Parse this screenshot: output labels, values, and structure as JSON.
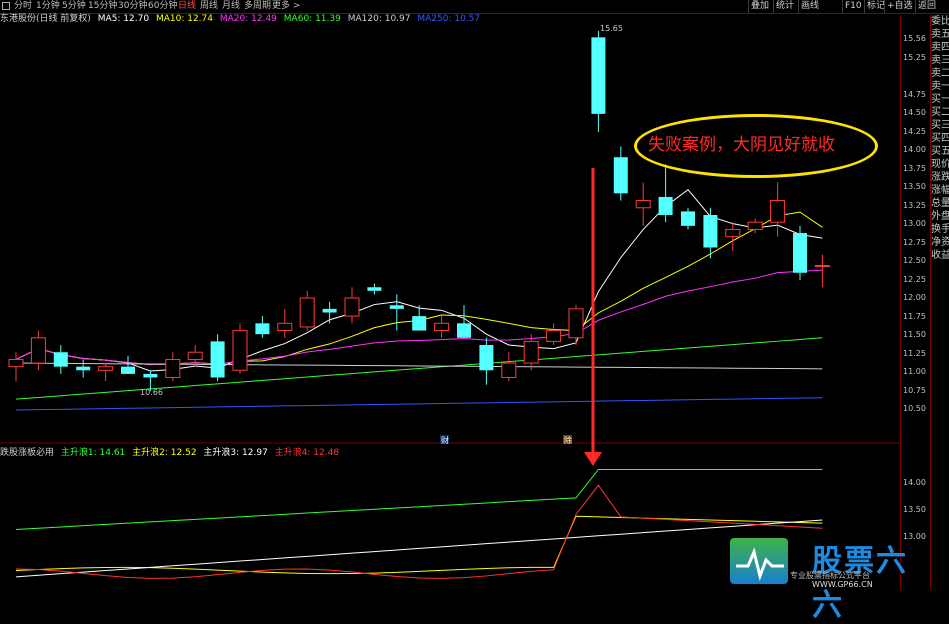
{
  "top_tabs": {
    "items": [
      "分时",
      "1分钟",
      "5分钟",
      "15分钟",
      "30分钟",
      "60分钟",
      "日线",
      "周线",
      "月线",
      "多周期",
      "更多 >"
    ],
    "active": "日线",
    "buttons": [
      "叠加",
      "统计",
      "画线",
      "F10",
      "标记",
      "+自选",
      "返回"
    ]
  },
  "ma_legend": {
    "stock": "东港股份(日线 前复权)",
    "items": [
      {
        "text": "MA5: 12.70",
        "color": "#ffffff"
      },
      {
        "text": "MA10: 12.74",
        "color": "#ffff00"
      },
      {
        "text": "MA20: 12.49",
        "color": "#ff33ff"
      },
      {
        "text": "MA60: 11.39",
        "color": "#33ff33"
      },
      {
        "text": "MA120: 10.97",
        "color": "#cccccc"
      },
      {
        "text": "MA250: 10.57",
        "color": "#3355ff"
      }
    ]
  },
  "indicator_legend": {
    "name": "跌股涨板必用",
    "items": [
      {
        "text": "主升浪1: 14.61",
        "color": "#33ff33"
      },
      {
        "text": "主升浪2: 12.52",
        "color": "#ffff00"
      },
      {
        "text": "主升浪3: 12.97",
        "color": "#ffffff"
      },
      {
        "text": "主升浪4: 12.48",
        "color": "#ff3333"
      }
    ]
  },
  "price_axis": [
    "15.56",
    "15.25",
    "14.75",
    "14.50",
    "14.25",
    "14.00",
    "13.75",
    "13.50",
    "13.25",
    "13.00",
    "12.75",
    "12.50",
    "12.25",
    "12.00",
    "11.75",
    "11.50",
    "11.25",
    "11.00",
    "10.75",
    "10.50"
  ],
  "indicator_axis": [
    "14.00",
    "13.50",
    "13.00"
  ],
  "price_annotations": {
    "high": "15.65",
    "low": "10.66"
  },
  "marker_labels": [
    "财",
    "除"
  ],
  "sidebar_items": [
    "委比",
    "卖五",
    "卖四",
    "卖三",
    "卖二",
    "卖一",
    "买一",
    "买二",
    "买三",
    "买四",
    "买五",
    "现价",
    "涨跌",
    "涨幅",
    "总量",
    "外盘",
    "换手",
    "净资",
    "收益"
  ],
  "annotation": {
    "text": "失败案例，大阴见好就收",
    "ellipse_color": "#ffe300",
    "text_color": "#ff2a2a"
  },
  "watermark": {
    "title": "股票六六",
    "subtitle": "专业股票指标公式平台",
    "url": "WWW.GP66.CN"
  },
  "candles": [
    {
      "o": 11.0,
      "h": 11.2,
      "l": 10.8,
      "c": 11.1
    },
    {
      "o": 11.05,
      "h": 11.5,
      "l": 10.95,
      "c": 11.4
    },
    {
      "o": 11.2,
      "h": 11.3,
      "l": 10.9,
      "c": 11.0
    },
    {
      "o": 11.0,
      "h": 11.1,
      "l": 10.85,
      "c": 10.95
    },
    {
      "o": 10.95,
      "h": 11.05,
      "l": 10.8,
      "c": 11.0
    },
    {
      "o": 11.0,
      "h": 11.15,
      "l": 10.9,
      "c": 10.9
    },
    {
      "o": 10.9,
      "h": 10.95,
      "l": 10.66,
      "c": 10.85
    },
    {
      "o": 10.85,
      "h": 11.2,
      "l": 10.8,
      "c": 11.1
    },
    {
      "o": 11.1,
      "h": 11.3,
      "l": 11.0,
      "c": 11.2
    },
    {
      "o": 11.35,
      "h": 11.45,
      "l": 10.8,
      "c": 10.85
    },
    {
      "o": 10.95,
      "h": 11.6,
      "l": 10.9,
      "c": 11.5
    },
    {
      "o": 11.6,
      "h": 11.7,
      "l": 11.4,
      "c": 11.45
    },
    {
      "o": 11.5,
      "h": 11.8,
      "l": 11.4,
      "c": 11.6
    },
    {
      "o": 11.55,
      "h": 12.05,
      "l": 11.5,
      "c": 11.95
    },
    {
      "o": 11.8,
      "h": 11.9,
      "l": 11.6,
      "c": 11.75
    },
    {
      "o": 11.7,
      "h": 12.1,
      "l": 11.6,
      "c": 11.95
    },
    {
      "o": 12.1,
      "h": 12.15,
      "l": 12.0,
      "c": 12.05
    },
    {
      "o": 11.85,
      "h": 12.0,
      "l": 11.5,
      "c": 11.8
    },
    {
      "o": 11.7,
      "h": 11.85,
      "l": 11.5,
      "c": 11.5
    },
    {
      "o": 11.5,
      "h": 11.7,
      "l": 11.4,
      "c": 11.6
    },
    {
      "o": 11.6,
      "h": 11.85,
      "l": 11.4,
      "c": 11.4
    },
    {
      "o": 11.3,
      "h": 11.4,
      "l": 10.75,
      "c": 10.95
    },
    {
      "o": 10.85,
      "h": 11.2,
      "l": 10.8,
      "c": 11.05
    },
    {
      "o": 11.05,
      "h": 11.45,
      "l": 10.95,
      "c": 11.35
    },
    {
      "o": 11.35,
      "h": 11.6,
      "l": 11.3,
      "c": 11.5
    },
    {
      "o": 11.4,
      "h": 11.85,
      "l": 11.3,
      "c": 11.8
    },
    {
      "o": 15.56,
      "h": 15.65,
      "l": 14.25,
      "c": 14.5
    },
    {
      "o": 13.9,
      "h": 14.05,
      "l": 13.3,
      "c": 13.4
    },
    {
      "o": 13.2,
      "h": 13.55,
      "l": 12.95,
      "c": 13.3
    },
    {
      "o": 13.35,
      "h": 13.8,
      "l": 13.0,
      "c": 13.1
    },
    {
      "o": 13.15,
      "h": 13.2,
      "l": 12.9,
      "c": 12.95
    },
    {
      "o": 13.1,
      "h": 13.2,
      "l": 12.5,
      "c": 12.65
    },
    {
      "o": 12.8,
      "h": 13.0,
      "l": 12.6,
      "c": 12.9
    },
    {
      "o": 12.9,
      "h": 13.05,
      "l": 12.85,
      "c": 13.0
    },
    {
      "o": 13.0,
      "h": 13.55,
      "l": 12.8,
      "c": 13.3
    },
    {
      "o": 12.85,
      "h": 12.95,
      "l": 12.2,
      "c": 12.3
    },
    {
      "o": 12.4,
      "h": 12.55,
      "l": 12.1,
      "c": 12.4
    }
  ]
}
